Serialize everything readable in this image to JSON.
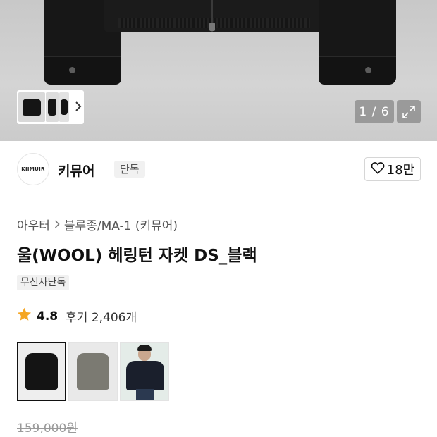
{
  "gallery": {
    "counter": "1 / 6",
    "thumbnails": [
      "jacket-front",
      "jacket-side",
      "jacket-back"
    ],
    "next_icon": "chevron-right-icon",
    "expand_icon": "expand-icon"
  },
  "brand": {
    "logo_text": "KIIMUIR",
    "name": "키뮤어",
    "tag": "단독",
    "likes": "18만",
    "like_icon": "heart-icon"
  },
  "product": {
    "breadcrumb": [
      "아우터",
      "블루종/MA-1 (키뮤어)"
    ],
    "title": "울(WOOL) 헤링턴 자켓 DS_블랙",
    "exclusive_badge": "무신사단독",
    "rating": "4.8",
    "rating_color": "#f5a623",
    "reviews": "후기 2,406개",
    "options": [
      {
        "name": "black-jacket",
        "color": "#141414",
        "selected": true
      },
      {
        "name": "gray-jacket",
        "color": "#7b7a72",
        "selected": false
      },
      {
        "name": "model-wearing-navy-jacket",
        "color": "#1a1f2c",
        "selected": false
      }
    ],
    "original_price": "159,000원"
  }
}
